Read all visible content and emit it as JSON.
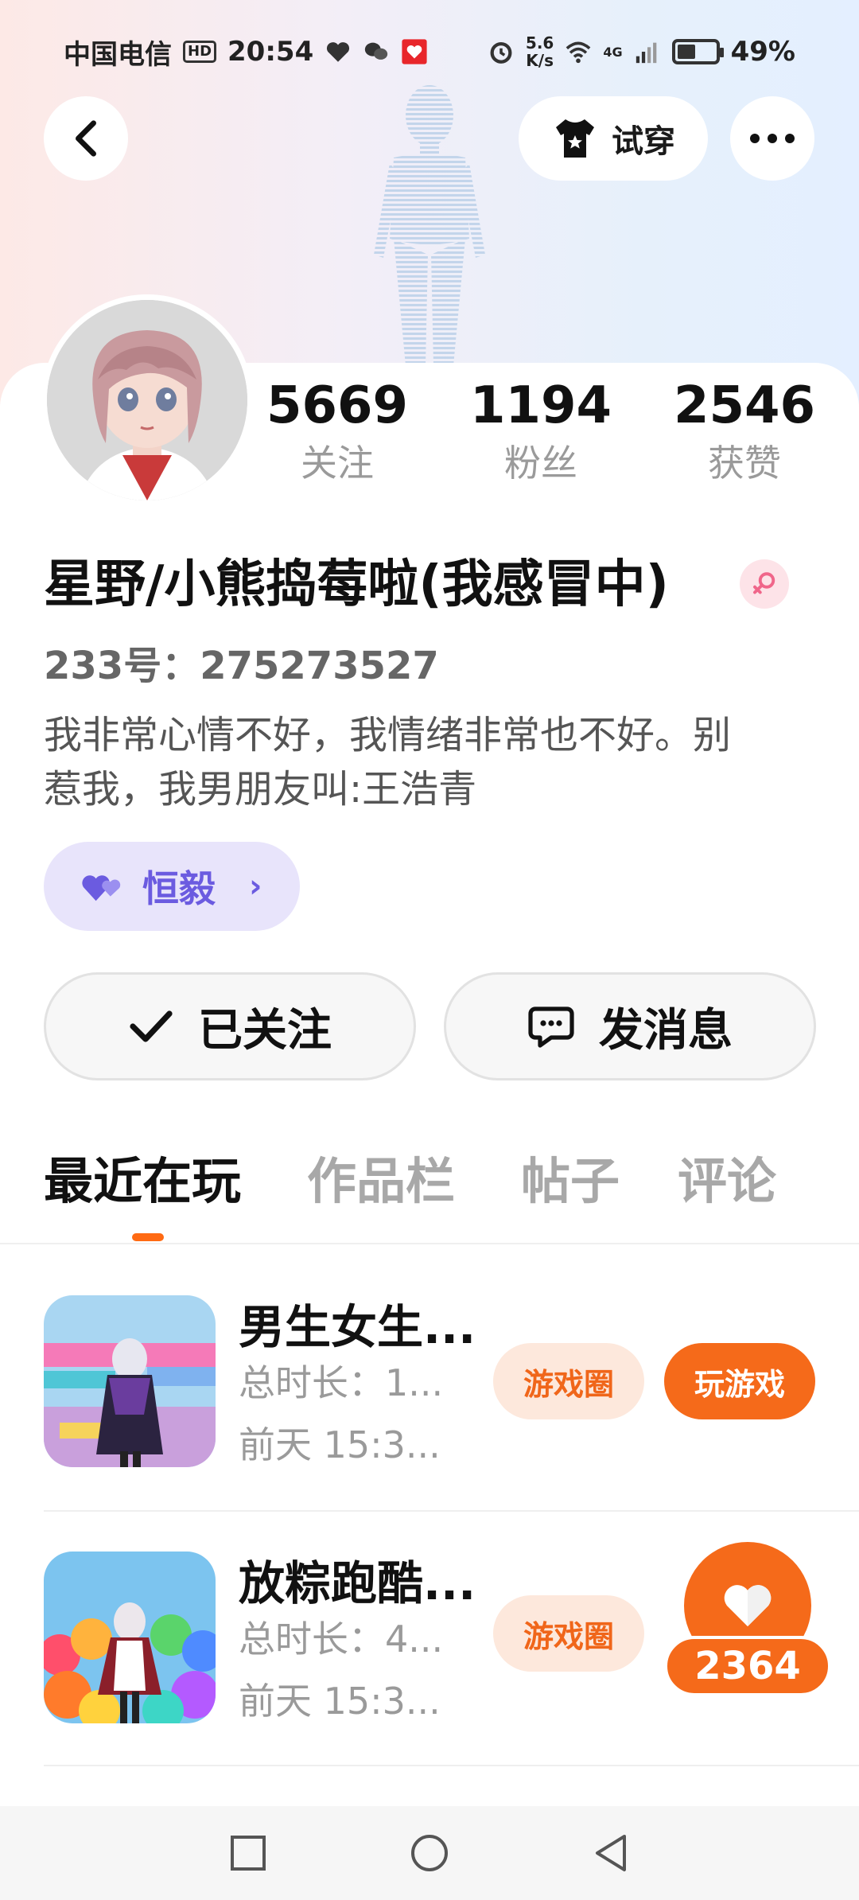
{
  "status_bar": {
    "carrier": "中国电信",
    "hd": "HD",
    "time": "20:54",
    "speed_value": "5.6",
    "speed_unit": "K/s",
    "network": "4G",
    "battery": "49%"
  },
  "top_nav": {
    "try_on_label": "试穿"
  },
  "profile": {
    "stats": [
      {
        "value": "5669",
        "label": "关注"
      },
      {
        "value": "1194",
        "label": "粉丝"
      },
      {
        "value": "2546",
        "label": "获赞"
      }
    ],
    "nickname": "星野/小熊捣莓啦(我感冒中)",
    "id_text": "233号：275273527",
    "bio_line1": "我非常心情不好，我情绪非常也不好。别",
    "bio_line2": "惹我，我男朋友叫:王浩青",
    "partner_name": "恒毅"
  },
  "actions": {
    "follow_label": "已关注",
    "message_label": "发消息"
  },
  "tabs": [
    "最近在玩",
    "作品栏",
    "帖子",
    "评论"
  ],
  "games": [
    {
      "title": "男生女生...",
      "duration": "总时长：1...",
      "last_played": "前天 15:3...",
      "circle_label": "游戏圈",
      "play_label": "玩游戏"
    },
    {
      "title": "放粽跑酷...",
      "duration": "总时长：4...",
      "last_played": "前天 15:3...",
      "circle_label": "游戏圈"
    }
  ],
  "like_button": {
    "count": "2364"
  },
  "colors": {
    "accent": "#f56a1a",
    "partner_purple": "#6b5be0"
  }
}
